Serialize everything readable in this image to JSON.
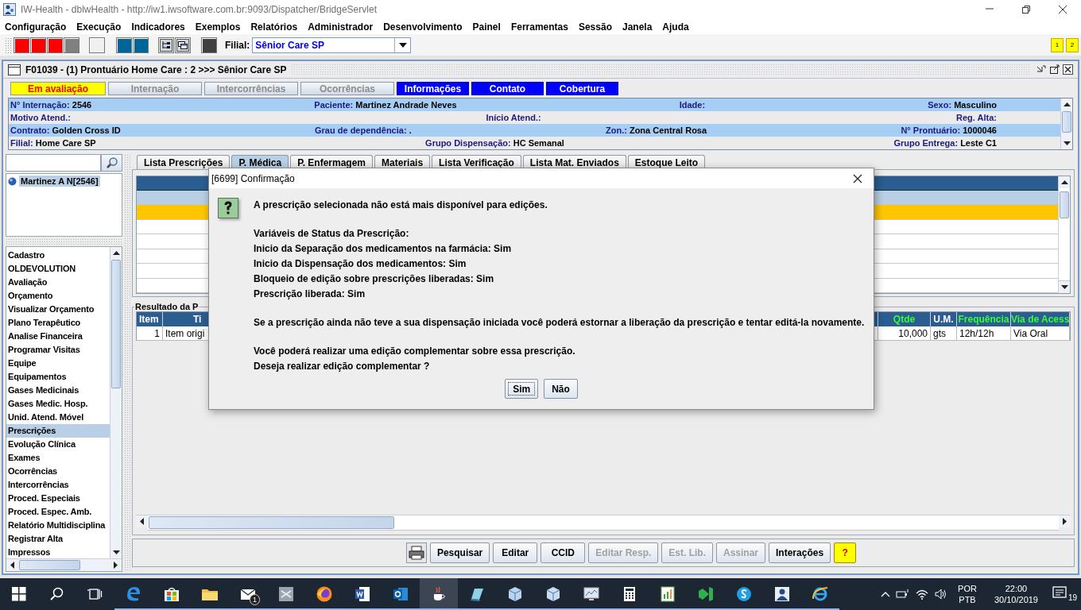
{
  "window": {
    "title": "IW-Health - dblwHealth - http://iw1.iwsoftware.com.br:9093/Dispatcher/BridgeServlet"
  },
  "menu": [
    "Configuração",
    "Execução",
    "Indicadores",
    "Exemplos",
    "Relatórios",
    "Administrador",
    "Desenvolvimento",
    "Painel",
    "Ferramentas",
    "Sessão",
    "Janela",
    "Ajuda"
  ],
  "toolbar": {
    "tool_buttons": [
      {
        "kind": "swatch",
        "color": "#ff0000"
      },
      {
        "kind": "swatch",
        "color": "#ff0000"
      },
      {
        "kind": "swatch",
        "color": "#ff0000"
      },
      {
        "kind": "swatch",
        "color": "#808080"
      },
      {
        "kind": "swatch",
        "color": "#f0f0f0"
      },
      {
        "kind": "swatch",
        "color": "#006699"
      },
      {
        "kind": "swatch",
        "color": "#006699"
      },
      {
        "kind": "icon"
      },
      {
        "kind": "icon"
      },
      {
        "kind": "swatch",
        "color": "#404040"
      }
    ],
    "filial_label": "Filial:",
    "filial_value": "Sênior Care SP",
    "badges": [
      "1",
      "2"
    ]
  },
  "frame": {
    "title": "F01039 - (1) Prontuário Home Care : 2 >>> Sênior Care SP"
  },
  "status_tabs": [
    {
      "label": "Em avaliação",
      "kind": "alert"
    },
    {
      "label": "Internação",
      "kind": "inactive"
    },
    {
      "label": "Intercorrências",
      "kind": "inactive"
    },
    {
      "label": "Ocorrências",
      "kind": "inactive"
    },
    {
      "label": "Informações",
      "kind": "active"
    },
    {
      "label": "Contato",
      "kind": "active"
    },
    {
      "label": "Cobertura",
      "kind": "active"
    }
  ],
  "patient_info": [
    {
      "fields": [
        {
          "label": "N° Internação:",
          "value": "2546"
        },
        {
          "label": "Paciente:",
          "value": "Martinez Andrade Neves"
        },
        {
          "label": "Idade:"
        },
        {
          "label": "Sexo:",
          "value": "Masculino"
        }
      ]
    },
    {
      "fields": [
        {
          "label": "Motivo Atend.:"
        },
        {
          "label": "Início Atend.:"
        },
        {
          "label": "Reg. Alta:"
        }
      ]
    },
    {
      "fields": [
        {
          "label": "Contrato:",
          "value": "Golden Cross ID"
        },
        {
          "label": "Grau de dependência:",
          "value": "."
        },
        {
          "label": "Zon.:",
          "value": "Zona Central Rosa"
        },
        {
          "label": "N° Prontuário:",
          "value": "1000046"
        }
      ]
    },
    {
      "fields": [
        {
          "label": "Filial:",
          "value": "Home Care SP"
        },
        {
          "label": "Grupo Dispensação:",
          "value": "HC Semanal"
        },
        {
          "label": "Grupo Entrega:",
          "value": "Leste C1"
        }
      ]
    }
  ],
  "sidebar": {
    "tree": [
      {
        "label": "Martinez A N[2546]",
        "selected": true
      }
    ],
    "items": [
      {
        "label": "Cadastro",
        "selected": false
      },
      {
        "label": "OLDEVOLUTION",
        "selected": false
      },
      {
        "label": "Avaliação",
        "selected": false
      },
      {
        "label": "Orçamento",
        "selected": false
      },
      {
        "label": "Visualizar Orçamento",
        "selected": false
      },
      {
        "label": "Plano Terapêutico",
        "selected": false
      },
      {
        "label": "Analise Financeira",
        "selected": false
      },
      {
        "label": "Programar Visitas",
        "selected": false
      },
      {
        "label": "Equipe",
        "selected": false
      },
      {
        "label": "Equipamentos",
        "selected": false
      },
      {
        "label": "Gases Medicinais",
        "selected": false
      },
      {
        "label": "Gases Medic. Hosp.",
        "selected": false
      },
      {
        "label": "Unid. Atend. Móvel",
        "selected": false
      },
      {
        "label": "Prescrições",
        "selected": true
      },
      {
        "label": "Evolução Clínica",
        "selected": false
      },
      {
        "label": "Exames",
        "selected": false
      },
      {
        "label": "Ocorrências",
        "selected": false
      },
      {
        "label": "Intercorrências",
        "selected": false
      },
      {
        "label": "Proced. Especiais",
        "selected": false
      },
      {
        "label": "Proced. Espec. Amb.",
        "selected": false
      },
      {
        "label": "Relatório Multidisciplina",
        "selected": false
      },
      {
        "label": "Registrar Alta",
        "selected": false
      },
      {
        "label": "Impressos",
        "selected": false
      }
    ]
  },
  "tabs": [
    {
      "label": "Lista Prescrições",
      "selected": false
    },
    {
      "label": "P. Médica",
      "selected": true
    },
    {
      "label": "P. Enfermagem",
      "selected": false
    },
    {
      "label": "Materiais",
      "selected": false
    },
    {
      "label": "Lista Verificação",
      "selected": false
    },
    {
      "label": "Lista Mat. Enviados",
      "selected": false
    },
    {
      "label": "Estoque Leito",
      "selected": false
    }
  ],
  "prescription_table": {
    "rows": [
      {
        "selected": true
      },
      {
        "selected": false,
        "color": "#ffc600"
      },
      {
        "selected": false
      },
      {
        "selected": false
      },
      {
        "selected": false
      },
      {
        "selected": false
      },
      {
        "selected": false
      }
    ]
  },
  "results": {
    "title": "Resultado da P",
    "columns": [
      {
        "label": "Item",
        "highlighted": false
      },
      {
        "label": "Ti",
        "highlighted": false
      },
      {
        "label": "Qtde",
        "highlighted": true
      },
      {
        "label": "U.M.",
        "highlighted": false
      },
      {
        "label": "Frequência",
        "highlighted": true
      },
      {
        "label": "Via de Acess",
        "highlighted": true
      }
    ],
    "rows": [
      [
        "1",
        "Item origi",
        "10,000",
        "gts",
        "12h/12h",
        "Via Oral"
      ]
    ]
  },
  "actions": [
    {
      "label": "Pesquisar",
      "kind": "normal",
      "disabled": false
    },
    {
      "label": "Editar",
      "kind": "normal",
      "disabled": false
    },
    {
      "label": "CCID",
      "kind": "normal",
      "disabled": false
    },
    {
      "label": "Editar Resp.",
      "kind": "normal",
      "disabled": true
    },
    {
      "label": "Est. Lib.",
      "kind": "normal",
      "disabled": true
    },
    {
      "label": "Assinar",
      "kind": "normal",
      "disabled": true
    },
    {
      "label": "Interações",
      "kind": "normal",
      "disabled": false
    },
    {
      "label": "?",
      "kind": "help",
      "disabled": false
    }
  ],
  "dialog": {
    "title": "[6699] Confirmação",
    "paragraphs": [
      [
        "A prescrição selecionada não está mais disponível para edições."
      ],
      [
        "Variáveis de Status da Prescrição:",
        "Inicio da Separação dos medicamentos na farmácia: Sim",
        "Inicio da Dispensação dos medicamentos: Sim",
        "Bloqueio de edição sobre prescrições liberadas: Sim",
        "Prescrição liberada: Sim"
      ],
      [
        "Se a prescrição ainda não teve a sua dispensação iniciada você poderá estornar a liberação da prescrição e tentar editá-la novamente."
      ],
      [
        "Você poderá realizar uma edição complementar sobre essa prescrição.",
        "Deseja realizar edição complementar ?"
      ]
    ],
    "buttons": [
      {
        "label": "Sim",
        "focused": true
      },
      {
        "label": "Não",
        "focused": false
      }
    ]
  },
  "taskbar": {
    "apps": [
      {
        "active": false
      },
      {
        "active": false
      },
      {
        "active": false
      },
      {
        "active": false,
        "badge": "1"
      },
      {
        "active": false
      },
      {
        "active": false
      },
      {
        "active": false
      },
      {
        "active": false
      },
      {
        "active": true
      },
      {
        "active": false
      },
      {
        "active": false
      },
      {
        "active": false
      },
      {
        "active": false
      },
      {
        "active": false
      },
      {
        "active": false
      },
      {
        "active": false
      },
      {
        "active": false
      },
      {
        "active": false
      },
      {
        "active": false
      }
    ],
    "language": [
      "POR",
      "PTB"
    ],
    "time": "22:00",
    "date": "30/10/2019",
    "notifications": "19"
  }
}
